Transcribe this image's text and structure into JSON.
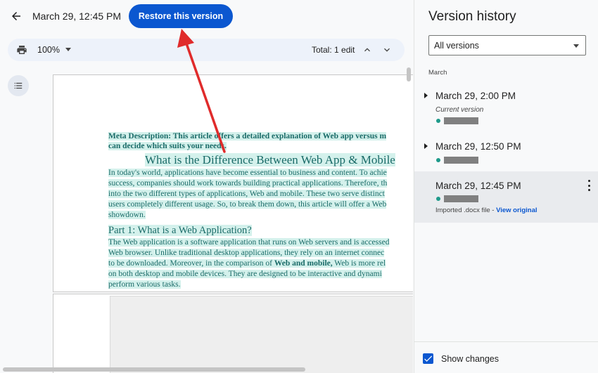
{
  "header": {
    "date": "March 29, 12:45 PM",
    "restore_label": "Restore this version"
  },
  "toolbar": {
    "zoom": "100%",
    "total_edits": "Total: 1 edit"
  },
  "document": {
    "meta_line1": "Meta Description: This article offers a detailed explanation of Web app versus m",
    "meta_line2": "can decide which suits your needs.",
    "title": "What is the Difference Between Web App & Mobile",
    "para1": [
      "In today's world, applications have become essential to business and content. To achie",
      "success, companies should work towards building practical applications. Therefore, th",
      "into the two different types of applications, Web and mobile. These two serve distinct",
      "users completely different usage. So, to break them down, this article will offer a Web",
      "showdown."
    ],
    "h2": "Part 1: What is a Web Application?",
    "para2_l1": "The Web application is a software application that runs on Web servers and is accessed",
    "para2_l2": "Web browser. Unlike traditional desktop applications, they rely on an internet connec",
    "para2_l3a": "to be downloaded. Moreover, in the comparison of ",
    "para2_l3b": "Web and mobile,",
    "para2_l3c": " Web is more rel",
    "para2_l4": "on both desktop and mobile devices. They are designed to be interactive and dynami",
    "para2_l5": "perform various tasks."
  },
  "panel": {
    "title": "Version history",
    "filter": "All versions",
    "month": "March",
    "versions": [
      {
        "time": "March 29, 2:00 PM",
        "subtitle": "Current version"
      },
      {
        "time": "March 29, 12:50 PM"
      },
      {
        "time": "March 29, 12:45 PM",
        "imported": "Imported .docx file - ",
        "view_original": "View original"
      }
    ],
    "show_changes": "Show changes",
    "show_changes_checked": true
  },
  "colors": {
    "accent": "#0b57d0",
    "highlight": "#d4f1ec",
    "doc_text": "#1a6b68",
    "editor_dot": "#1e9a8a",
    "annotation_arrow": "#e02b2b"
  },
  "icons": {
    "back": "arrow-left-icon",
    "print": "printer-icon",
    "outline": "list-icon",
    "menu": "more-vert-icon"
  }
}
